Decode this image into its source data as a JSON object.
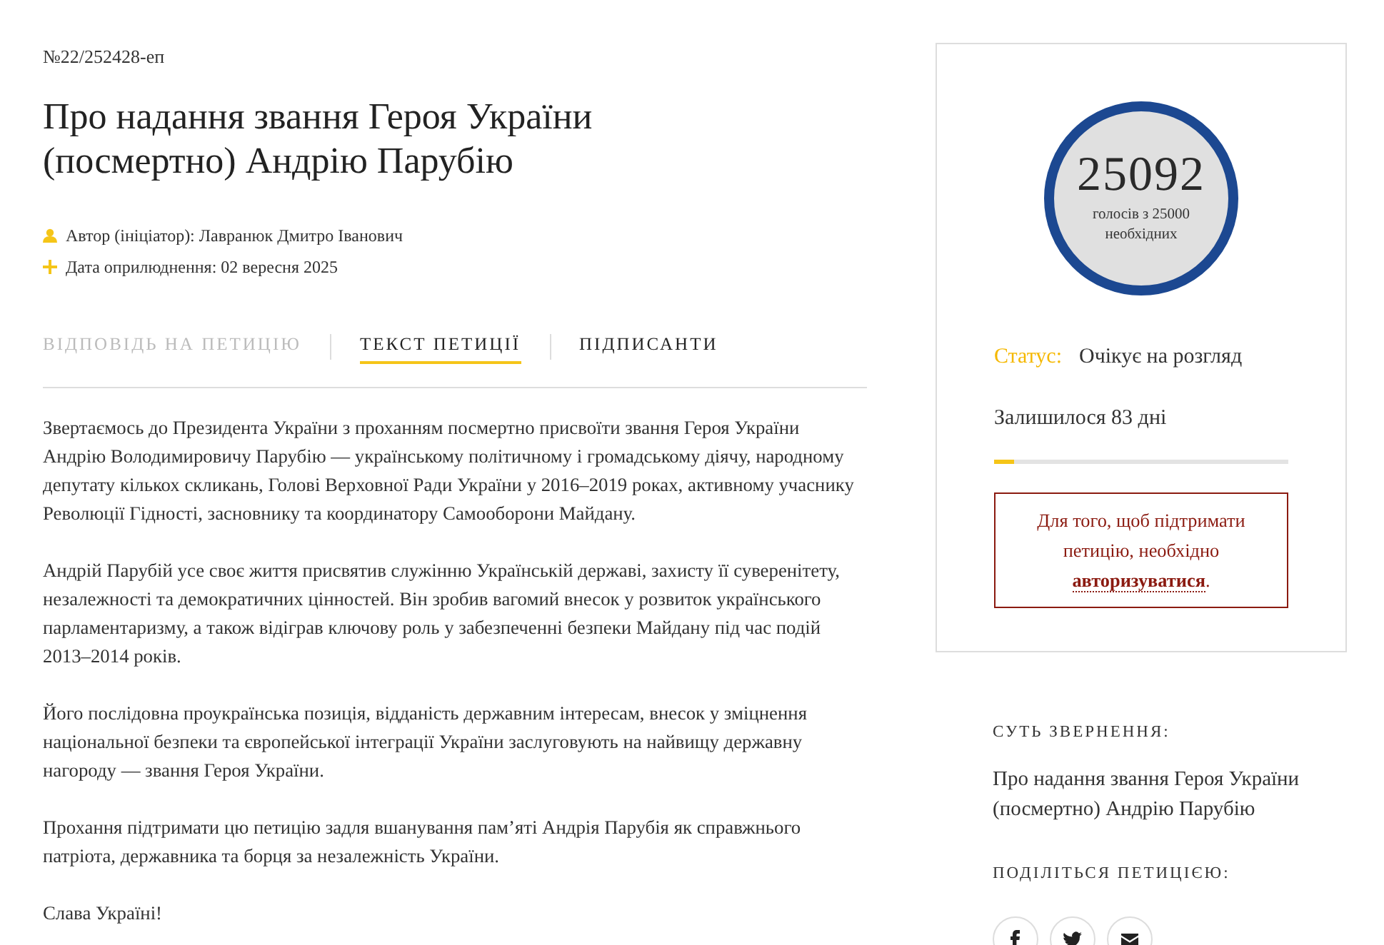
{
  "petition": {
    "number": "№22/252428-еп",
    "title": "Про надання звання Героя України (посмертно) Андрію Парубію",
    "meta": [
      {
        "kind": "author",
        "text": "Автор (ініціатор): Лавранюк Дмитро Іванович"
      },
      {
        "kind": "date",
        "text": "Дата оприлюднення: 02 вересня 2025"
      }
    ]
  },
  "tabs": [
    {
      "label": "ВІДПОВІДЬ НА ПЕТИЦІЮ",
      "selected": false,
      "disabled": true
    },
    {
      "label": "ТЕКСТ ПЕТИЦІЇ",
      "selected": true,
      "disabled": false
    },
    {
      "label": "ПІДПИСАНТИ",
      "selected": false,
      "disabled": false
    }
  ],
  "body": [
    "Звертаємось до Президента України з проханням посмертно присвоїти звання Героя України Андрію Володимировичу Парубію — українському політичному і громадському діячу, народному депутату кількох скликань, Голові Верховної Ради України у 2016–2019 роках, активному учаснику Революції Гідності, засновнику та координатору Самооборони Майдану.",
    "Андрій Парубій усе своє життя присвятив служінню Українській державі, захисту її суверенітету, незалежності та демократичних цінностей. Він зробив вагомий внесок у розвиток українського парламентаризму, а також відіграв ключову роль у забезпеченні безпеки Майдану під час подій 2013–2014 років.",
    "Його послідовна проукраїнська позиція, відданість державним інтересам, внесок у зміцнення національної безпеки та європейської інтеграції України заслуговують на найвищу державну нагороду — звання Героя України.",
    "Прохання підтримати цю петицію задля вшанування пам’яті Андрія Парубія як справжнього патріота, державника та борця за незалежність України.",
    "Слава Україні!"
  ],
  "votes": {
    "count": "25092",
    "caption": "голосів з 25000 необхідних"
  },
  "status": {
    "label": "Статус:",
    "value": "Очікує на розгляд"
  },
  "remaining": {
    "text": "Залишилося 83 дні",
    "level": 0.07
  },
  "notice": {
    "text": "Для того, щоб підтримати петицію, необхідно",
    "link": "авторизуватися",
    "after": "."
  },
  "summary": {
    "heading": "СУТЬ ЗВЕРНЕННЯ:",
    "text": "Про надання звання Героя України (посмертно) Андрію Парубію"
  },
  "share": {
    "heading": "ПОДІЛІТЬСЯ ПЕТИЦІЄЮ:",
    "buttons": [
      {
        "kind": "facebook"
      },
      {
        "kind": "twitter"
      },
      {
        "kind": "email"
      }
    ]
  }
}
